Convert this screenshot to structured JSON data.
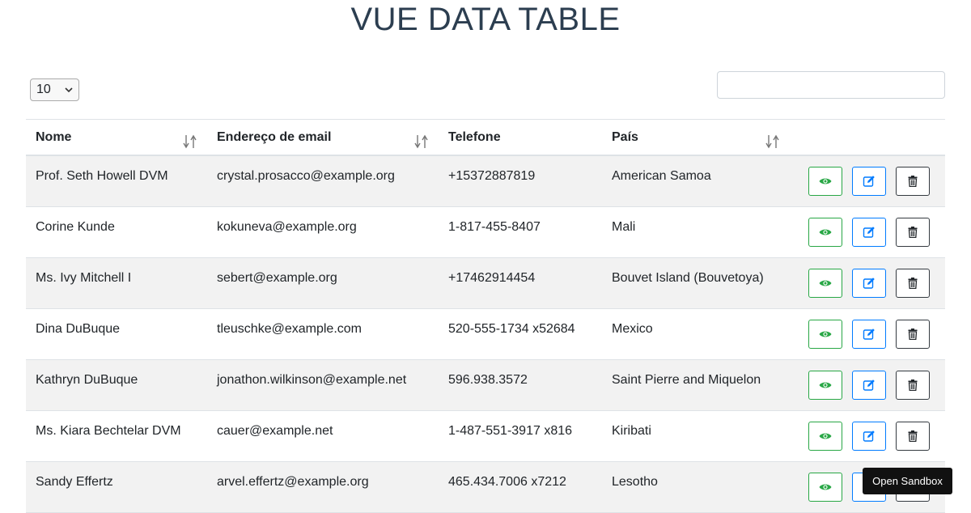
{
  "title": "VUE DATA TABLE",
  "per_page": {
    "selected": "10"
  },
  "search": {
    "value": "",
    "placeholder": ""
  },
  "table": {
    "headers": [
      "Nome",
      "Endereço de email",
      "Telefone",
      "País"
    ],
    "rows": [
      [
        "Prof. Seth Howell DVM",
        "crystal.prosacco@example.org",
        "+15372887819",
        "American Samoa"
      ],
      [
        "Corine Kunde",
        "kokuneva@example.org",
        "1-817-455-8407",
        "Mali"
      ],
      [
        "Ms. Ivy Mitchell I",
        "sebert@example.org",
        "+17462914454",
        "Bouvet Island (Bouvetoya)"
      ],
      [
        "Dina DuBuque",
        "tleuschke@example.com",
        "520-555-1734 x52684",
        "Mexico"
      ],
      [
        "Kathryn DuBuque",
        "jonathon.wilkinson@example.net",
        "596.938.3572",
        "Saint Pierre and Miquelon"
      ],
      [
        "Ms. Kiara Bechtelar DVM",
        "cauer@example.net",
        "1-487-551-3917 x816",
        "Kiribati"
      ],
      [
        "Sandy Effertz",
        "arvel.effertz@example.org",
        "465.434.7006 x7212",
        "Lesotho"
      ]
    ]
  },
  "icons": {
    "view": "eye-icon",
    "edit": "edit-icon",
    "delete": "trash-icon",
    "sort": "sort-arrows-icon"
  },
  "colors": {
    "view": "#28a745",
    "edit": "#007bff",
    "delete": "#343a40",
    "title": "#2c3e50"
  },
  "tooltip": {
    "text": "Open Sandbox"
  }
}
